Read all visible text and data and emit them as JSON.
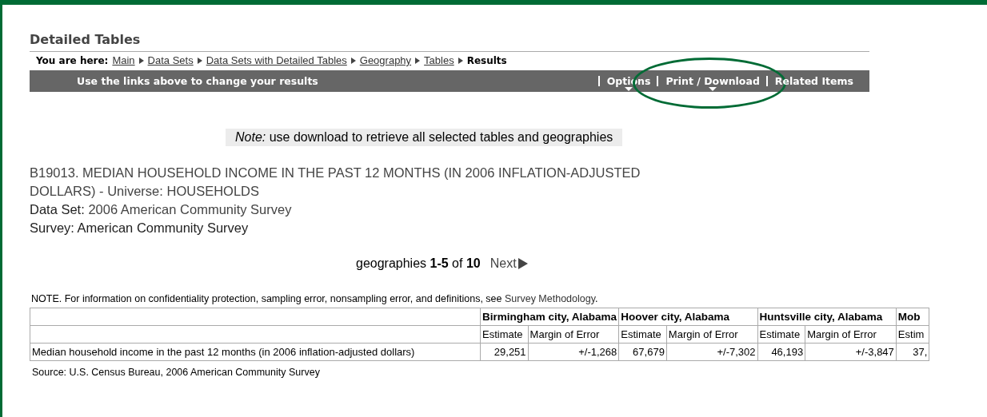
{
  "page_title": "Detailed Tables",
  "breadcrumb": {
    "label": "You are here:",
    "items": [
      {
        "label": "Main",
        "current": false
      },
      {
        "label": "Data Sets",
        "current": false
      },
      {
        "label": "Data Sets with Detailed Tables",
        "current": false
      },
      {
        "label": "Geography",
        "current": false
      },
      {
        "label": "Tables",
        "current": false
      },
      {
        "label": "Results",
        "current": true
      }
    ]
  },
  "menu_bar": {
    "hint": "Use the links above to change your results",
    "items": [
      {
        "label": "Options",
        "dropdown": true,
        "highlighted": false
      },
      {
        "label": "Print / Download",
        "dropdown": true,
        "highlighted": true
      },
      {
        "label": "Related Items",
        "dropdown": false,
        "highlighted": false
      }
    ]
  },
  "note": "*Note:* use download to retrieve all selected tables and geographies",
  "table_title": {
    "link": "B19013. MEDIAN HOUSEHOLD INCOME IN THE PAST 12 MONTHS (IN 2006 INFLATION-ADJUSTED DOLLARS) - Universe: HOUSEHOLDS",
    "data_set_label": "Data Set:",
    "data_set_link": "2006 American Community Survey",
    "survey": "Survey: American Community Survey"
  },
  "pagination": {
    "text": "geographies **1-5** of **10**",
    "next": "Next"
  },
  "table_note": {
    "text": "NOTE. For information on confidentiality protection, sampling error, nonsampling error, and definitions, see",
    "link": "Survey Methodology",
    "end": "."
  },
  "table": {
    "geographies": [
      {
        "name": "Birmingham city, Alabama",
        "columns": [
          "Estimate",
          "Margin of Error"
        ],
        "values": [
          "29,251",
          "+/-1,268"
        ]
      },
      {
        "name": "Hoover city, Alabama",
        "columns": [
          "Estimate",
          "Margin of Error"
        ],
        "values": [
          "67,679",
          "+/-7,302"
        ]
      },
      {
        "name": "Huntsville city, Alabama",
        "columns": [
          "Estimate",
          "Margin of Error"
        ],
        "values": [
          "46,193",
          "+/-3,847"
        ]
      },
      {
        "name": "Mob",
        "columns": [
          "Estim"
        ],
        "values": [
          "37,"
        ]
      }
    ],
    "row_label": "Median household income in the past 12 months (in 2006 inflation-adjusted dollars)"
  },
  "source": "Source: U.S. Census Bureau, 2006 American Community Survey"
}
